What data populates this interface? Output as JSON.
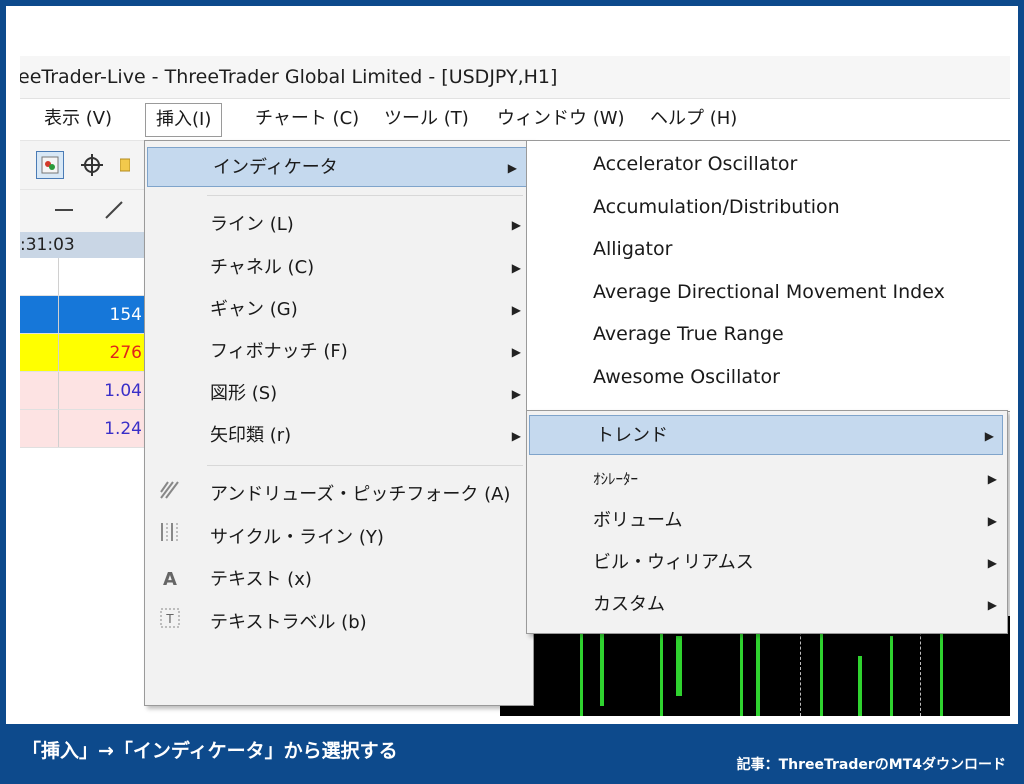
{
  "window": {
    "title": "eeTrader-Live - ThreeTrader Global Limited - [USDJPY,H1]"
  },
  "menubar": {
    "items": [
      "表示 (V)",
      "挿入(I)",
      "チャート (C)",
      "ツール (T)",
      "ウィンドウ (W)",
      "ヘルプ (H)"
    ],
    "active": "挿入(I)"
  },
  "sidebar": {
    "time": ":31:03",
    "rows": [
      "154",
      "276",
      "1.04",
      "1.24"
    ]
  },
  "insert_menu": {
    "indicator": "インディケータ",
    "line": "ライン (L)",
    "channel": "チャネル (C)",
    "gann": "ギャン (G)",
    "fibonacci": "フィボナッチ (F)",
    "shapes": "図形 (S)",
    "arrows": "矢印類 (r)",
    "andrews": "アンドリューズ・ピッチフォーク (A)",
    "cycle": "サイクル・ライン (Y)",
    "text": "テキスト (x)",
    "text_label": "テキストラベル (b)"
  },
  "indicator_submenu": {
    "items": [
      "Accelerator Oscillator",
      "Accumulation/Distribution",
      "Alligator",
      "Average Directional Movement Index",
      "Average True Range",
      "Awesome Oscillator"
    ]
  },
  "category_submenu": {
    "trend": "トレンド",
    "oscillator": "ｵｼﾚｰﾀｰ",
    "volume": "ボリューム",
    "bill_williams": "ビル・ウィリアムス",
    "custom": "カスタム"
  },
  "caption": {
    "left": "「挿入」→「インディケータ」から選択する",
    "right": "記事：ThreeTraderのMT4ダウンロード"
  },
  "colors": {
    "frame": "#0d4a8c",
    "highlight": "#c5d9ee",
    "row_blue": "#1677d9",
    "row_yellow": "#ffff00",
    "row_pink": "#fde3e3",
    "chart_bg": "#000000",
    "candle": "#2fd22f"
  }
}
